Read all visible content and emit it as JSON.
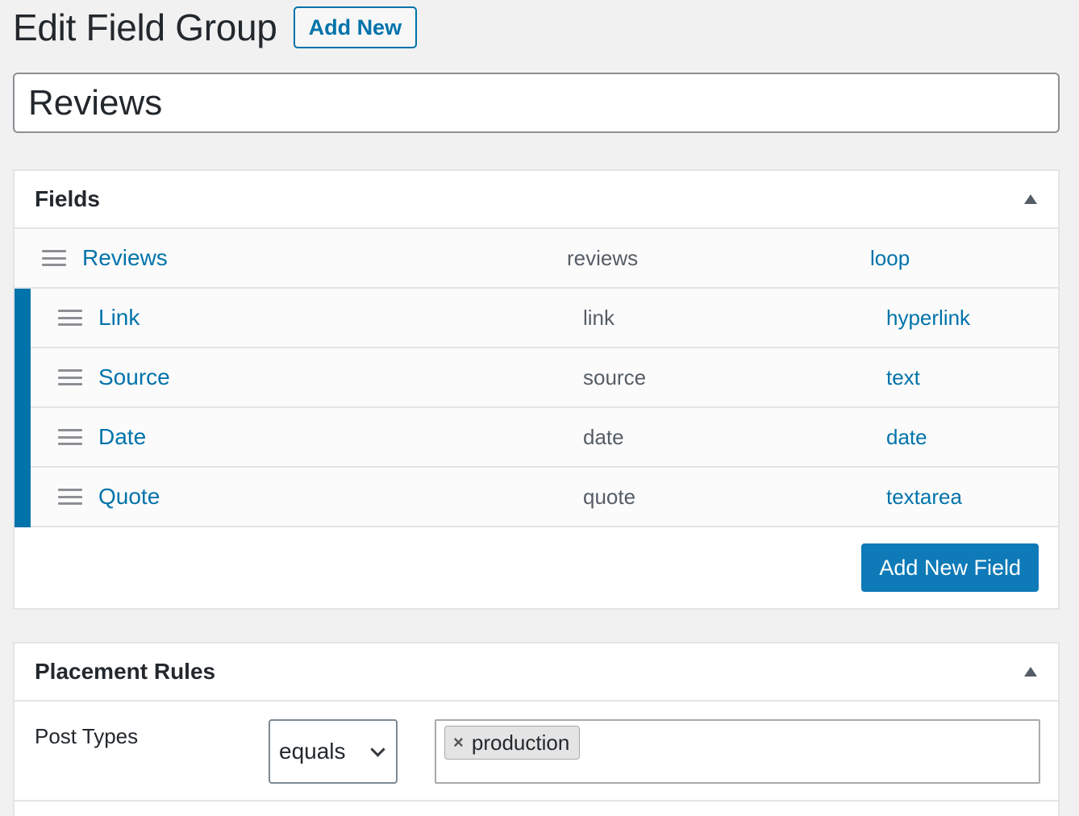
{
  "header": {
    "title": "Edit Field Group",
    "add_new_label": "Add New"
  },
  "group_title": {
    "value": "Reviews"
  },
  "fields_box": {
    "title": "Fields",
    "rows": [
      {
        "label": "Reviews",
        "name": "reviews",
        "type": "loop",
        "child": false
      },
      {
        "label": "Link",
        "name": "link",
        "type": "hyperlink",
        "child": true
      },
      {
        "label": "Source",
        "name": "source",
        "type": "text",
        "child": true
      },
      {
        "label": "Date",
        "name": "date",
        "type": "date",
        "child": true
      },
      {
        "label": "Quote",
        "name": "quote",
        "type": "textarea",
        "child": true
      }
    ],
    "add_field_label": "Add New Field"
  },
  "placement_box": {
    "title": "Placement Rules",
    "rule": {
      "label": "Post Types",
      "operator": "equals",
      "values": [
        "production"
      ]
    }
  },
  "colors": {
    "accent": "#0073aa",
    "primary_button": "#0e7ab8",
    "background": "#f1f1f1"
  }
}
